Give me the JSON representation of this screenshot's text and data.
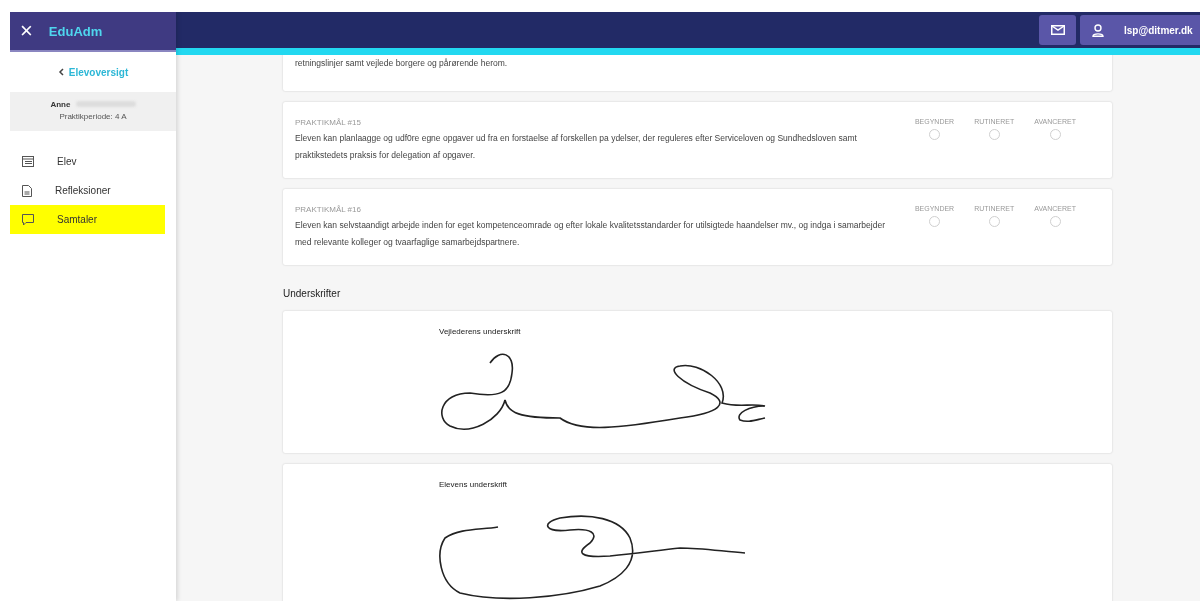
{
  "app": {
    "close": "×",
    "title": "EduAdm"
  },
  "header": {
    "user": "lsp@ditmer.dk"
  },
  "sidebar": {
    "back": "Elevoversigt",
    "student_name": "Anne",
    "period": "Praktikperiode: 4 A",
    "items": [
      {
        "label": "Elev",
        "kind": "list",
        "selected": false
      },
      {
        "label": "Refleksioner",
        "kind": "document",
        "selected": false
      },
      {
        "label": "Samtaler",
        "kind": "chat",
        "selected": true
      }
    ]
  },
  "goals": [
    {
      "text": "retningslinjer samt vejlede borgere og pårørende herom."
    },
    {
      "label": "PRAKTIKMÅL #15",
      "text": "Eleven kan planlaagge og udf0re egne opgaver ud fra en forstaelse af forskellen pa ydelser, der reguleres efter Serviceloven og Sundhedsloven samt praktikstedets praksis for delegation af opgaver.",
      "levels": [
        {
          "label": "BEGYNDER",
          "selected": false
        },
        {
          "label": "RUTINERET",
          "selected": false
        },
        {
          "label": "AVANCERET",
          "selected": false
        }
      ]
    },
    {
      "label": "PRAKTIKMÅL #16",
      "text": "Eleven kan selvstaandigt arbejde inden for eget kompetenceomrade og efter lokale kvalitetsstandarder for utilsigtede haandelser mv., og indga i samarbejder med relevante kolleger og tvaarfaglige samarbejdspartnere.",
      "levels": [
        {
          "label": "BEGYNDER",
          "selected": false
        },
        {
          "label": "RUTINERET",
          "selected": false
        },
        {
          "label": "AVANCERET",
          "selected": false
        }
      ]
    }
  ],
  "signatures_heading": "Underskrifter",
  "signatures": [
    {
      "label": "Vejlederens underskrift",
      "kind": "supervisor"
    },
    {
      "label": "Elevens underskrift",
      "kind": "student"
    }
  ]
}
